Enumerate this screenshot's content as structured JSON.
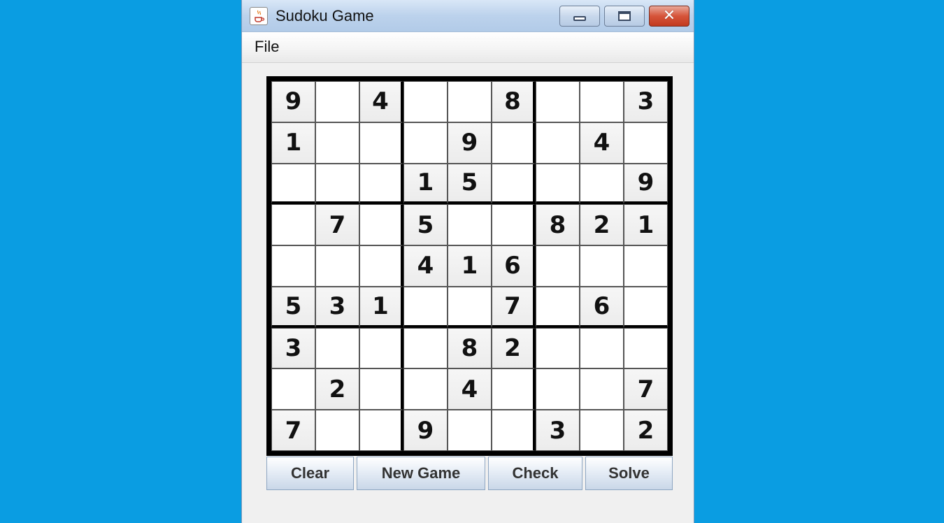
{
  "window": {
    "title": "Sudoku Game",
    "icon": "java-cup-icon",
    "controls": [
      "minimize",
      "maximize",
      "close"
    ]
  },
  "menu": {
    "items": [
      "File"
    ]
  },
  "board": {
    "grid": [
      [
        "9",
        "",
        "4",
        "",
        "",
        "8",
        "",
        "",
        "3"
      ],
      [
        "1",
        "",
        "",
        "",
        "9",
        "",
        "",
        "4",
        ""
      ],
      [
        "",
        "",
        "",
        "1",
        "5",
        "",
        "",
        "",
        "9"
      ],
      [
        "",
        "7",
        "",
        "5",
        "",
        "",
        "8",
        "2",
        "1"
      ],
      [
        "",
        "",
        "",
        "4",
        "1",
        "6",
        "",
        "",
        ""
      ],
      [
        "5",
        "3",
        "1",
        "",
        "",
        "7",
        "",
        "6",
        ""
      ],
      [
        "3",
        "",
        "",
        "",
        "8",
        "2",
        "",
        "",
        ""
      ],
      [
        "",
        "2",
        "",
        "",
        "4",
        "",
        "",
        "",
        "7"
      ],
      [
        "7",
        "",
        "",
        "9",
        "",
        "",
        "3",
        "",
        "2"
      ]
    ]
  },
  "buttons": {
    "clear": "Clear",
    "new_game": "New Game",
    "check": "Check",
    "solve": "Solve"
  },
  "colors": {
    "desktop": "#0a9de2",
    "window_bg": "#f0f0f0",
    "close_button": "#d6543a"
  }
}
